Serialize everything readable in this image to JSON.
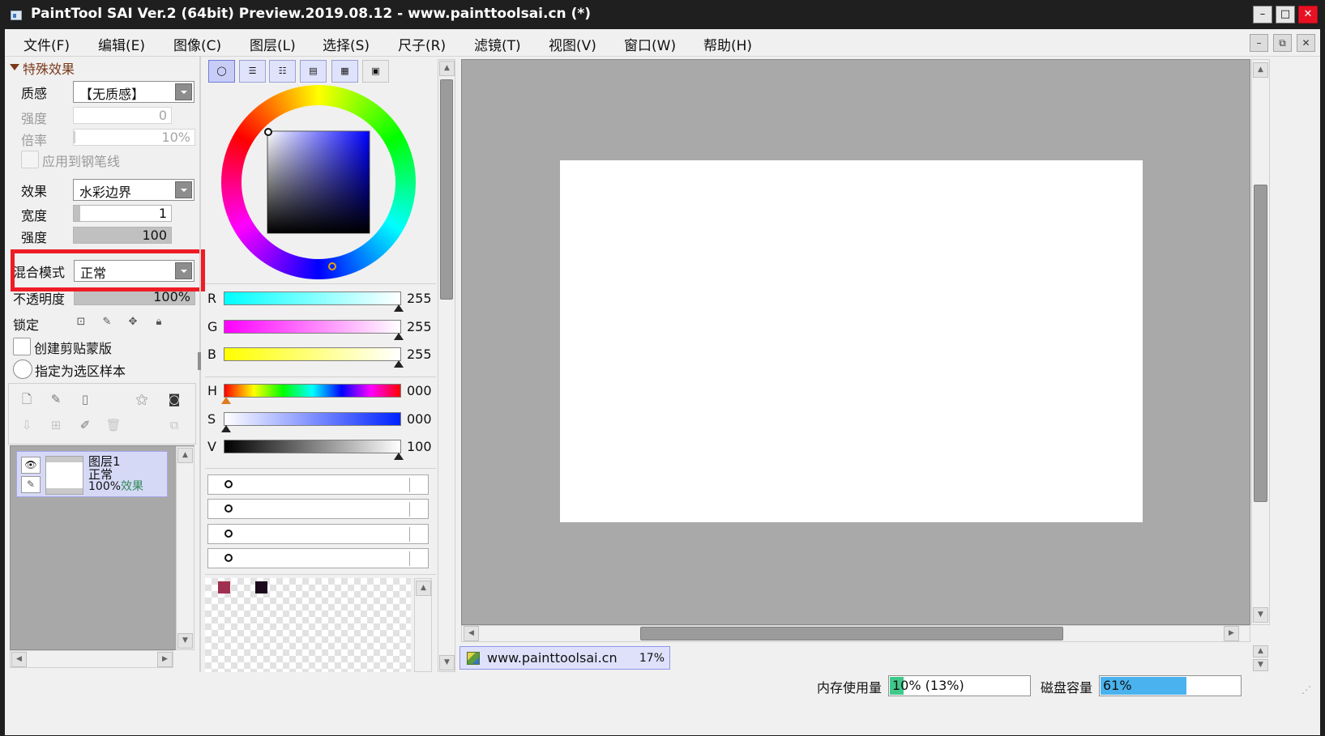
{
  "window": {
    "title": "PaintTool SAI Ver.2 (64bit) Preview.2019.08.12 - www.painttoolsai.cn (*)",
    "minimize_glyph": "–",
    "maximize_glyph": "□",
    "close_glyph": "✕"
  },
  "menu": {
    "items": [
      "文件(F)",
      "编辑(E)",
      "图像(C)",
      "图层(L)",
      "选择(S)",
      "尺子(R)",
      "滤镜(T)",
      "视图(V)",
      "窗口(W)",
      "帮助(H)"
    ],
    "mdi_minimize": "–",
    "mdi_restore": "⧉",
    "mdi_close": "✕"
  },
  "effects": {
    "section_title": "特殊效果",
    "texture_label": "质感",
    "texture_value": "【无质感】",
    "strength_label": "强度",
    "strength_value": "0",
    "scale_label": "倍率",
    "scale_value": "10%",
    "apply_brush_label": "应用到钢笔线",
    "effect_label": "效果",
    "effect_value": "水彩边界",
    "width_label": "宽度",
    "width_value": "1",
    "intensity_label": "强度",
    "intensity_value": "100"
  },
  "layer_props": {
    "blend_label": "混合模式",
    "blend_value": "正常",
    "opacity_label": "不透明度",
    "opacity_value": "100%",
    "lock_label": "锁定",
    "clip_label": "创建剪贴蒙版",
    "sample_label": "指定为选区样本"
  },
  "layers": [
    {
      "name": "图层1",
      "mode": "正常",
      "opacity": "100%",
      "effect": "效果"
    }
  ],
  "color": {
    "r_label": "R",
    "r_value": "255",
    "g_label": "G",
    "g_value": "255",
    "b_label": "B",
    "b_value": "255",
    "h_label": "H",
    "h_value": "000",
    "s_label": "S",
    "s_value": "000",
    "v_label": "V",
    "v_value": "100",
    "swatches": [
      "#a0304f",
      "#1a0a1c"
    ]
  },
  "document": {
    "name": "www.painttoolsai.cn",
    "zoom": "17%"
  },
  "status": {
    "memory_label": "内存使用量",
    "memory_value": "10% (13%)",
    "memory_level": 0.1,
    "disk_label": "磁盘容量",
    "disk_value": "61%",
    "disk_level": 0.61
  },
  "colors": {
    "highlight_box": "#ee1c24",
    "effect_text": "#2f8a5a",
    "memory_fill": "#3ec98b",
    "disk_fill": "#4ab3ef",
    "section_title": "#7a3a1a"
  }
}
